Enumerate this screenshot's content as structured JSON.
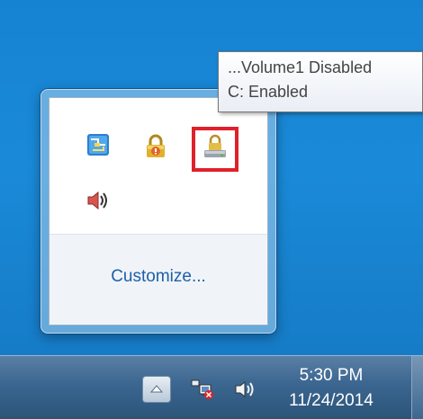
{
  "tooltip": {
    "line1": "...Volume1 Disabled",
    "line2": "C: Enabled"
  },
  "overflow_panel": {
    "customize_label": "Customize...",
    "icons": [
      "network-map-icon",
      "lock-warning-icon",
      "drive-lock-icon",
      "speaker-icon"
    ]
  },
  "taskbar": {
    "show_hidden_icons": "up-arrow-icon",
    "tray_icons": [
      "network-disconnected-icon",
      "volume-icon"
    ],
    "clock": {
      "time": "5:30 PM",
      "date": "11/24/2014"
    }
  },
  "colors": {
    "desktop": "#1683d2",
    "highlight": "#e0202a",
    "link": "#1d5fa8"
  }
}
